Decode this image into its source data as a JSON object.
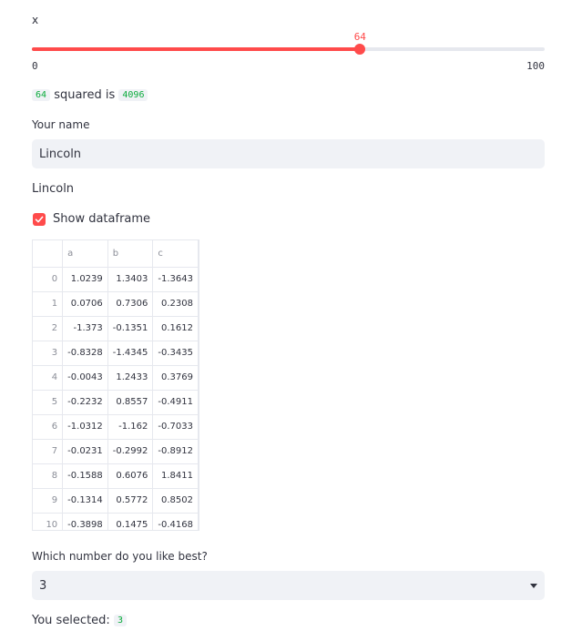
{
  "slider": {
    "label": "x",
    "value": 64,
    "value_text": "64",
    "min_text": "0",
    "max_text": "100",
    "min": 0,
    "max": 100,
    "accent": "#ff4b4b"
  },
  "squared": {
    "input": "64",
    "text": "squared is",
    "result": "4096"
  },
  "name_input": {
    "label": "Your name",
    "value": "Lincoln"
  },
  "name_echo": "Lincoln",
  "checkbox": {
    "label": "Show dataframe",
    "checked": true,
    "icon": "check-icon"
  },
  "dataframe": {
    "columns": [
      "",
      "a",
      "b",
      "c"
    ],
    "rows": [
      [
        "0",
        "1.0239",
        "1.3403",
        "-1.3643"
      ],
      [
        "1",
        "0.0706",
        "0.7306",
        "0.2308"
      ],
      [
        "2",
        "-1.373",
        "-0.1351",
        "0.1612"
      ],
      [
        "3",
        "-0.8328",
        "-1.4345",
        "-0.3435"
      ],
      [
        "4",
        "-0.0043",
        "1.2433",
        "0.3769"
      ],
      [
        "5",
        "-0.2232",
        "0.8557",
        "-0.4911"
      ],
      [
        "6",
        "-1.0312",
        "-1.162",
        "-0.7033"
      ],
      [
        "7",
        "-0.0231",
        "-0.2992",
        "-0.8912"
      ],
      [
        "8",
        "-0.1588",
        "0.6076",
        "1.8411"
      ],
      [
        "9",
        "-0.1314",
        "0.5772",
        "0.8502"
      ],
      [
        "10",
        "-0.3898",
        "0.1475",
        "-0.4168"
      ]
    ]
  },
  "select": {
    "label": "Which number do you like best?",
    "value": "3",
    "icon": "chevron-down-icon"
  },
  "selected": {
    "text": "You selected:",
    "value": "3"
  }
}
